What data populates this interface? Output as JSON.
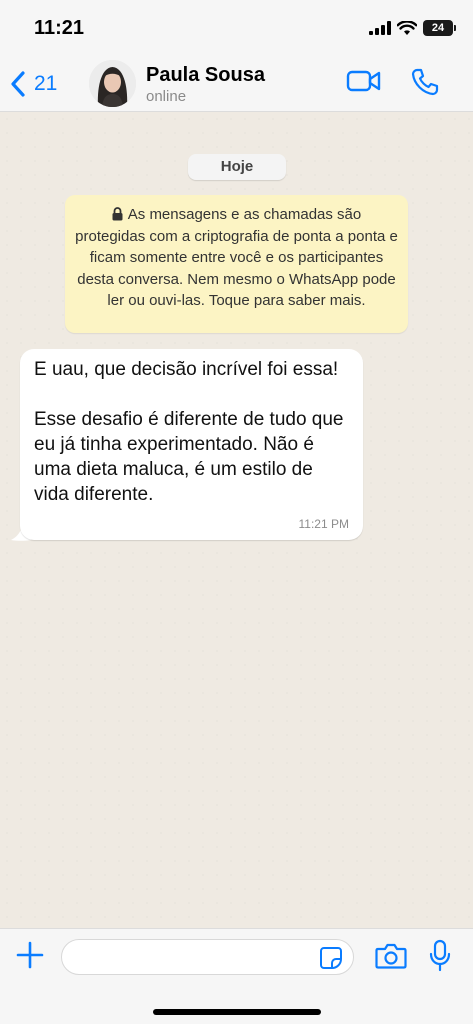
{
  "status_bar": {
    "time": "11:21",
    "battery": "24"
  },
  "header": {
    "back_count": "21",
    "contact_name": "Paula Sousa",
    "contact_status": "online",
    "accent_color": "#0a7cff"
  },
  "chat": {
    "date_label": "Hoje",
    "encryption_notice": "As mensagens e as chamadas são protegidas com a criptografia de ponta a ponta e ficam somente entre você e os participantes desta conversa. Nem mesmo o WhatsApp pode ler ou ouvi-las. Toque para saber mais.",
    "messages": [
      {
        "direction": "incoming",
        "text": "E uau, que decisão incrível foi essa!\n\nEsse desafio é diferente de tudo que eu já tinha experimentado. Não é uma dieta maluca, é um estilo de vida diferente.",
        "time": "11:21 PM"
      }
    ]
  },
  "composer": {
    "input_value": "",
    "icons": [
      "plus-icon",
      "sticker-icon",
      "camera-icon",
      "microphone-icon"
    ]
  },
  "colors": {
    "chat_background": "#efeae2",
    "notice_background": "#fcf4c4",
    "bubble_background": "#ffffff"
  }
}
